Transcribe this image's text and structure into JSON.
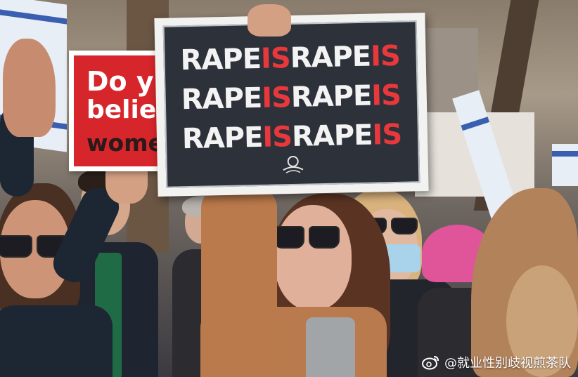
{
  "red_sign": {
    "line1": "Do y",
    "line2": "believe",
    "line3": "women"
  },
  "main_sign": {
    "rows": [
      [
        {
          "text": "RAPE",
          "tone": "white"
        },
        {
          "text": "IS",
          "tone": "red"
        },
        {
          "text": "RAPE",
          "tone": "white"
        },
        {
          "text": "IS",
          "tone": "red"
        }
      ],
      [
        {
          "text": "RAPE",
          "tone": "white"
        },
        {
          "text": "IS",
          "tone": "red"
        },
        {
          "text": "RAPE",
          "tone": "white"
        },
        {
          "text": "IS",
          "tone": "red"
        }
      ],
      [
        {
          "text": "RAPE",
          "tone": "white"
        },
        {
          "text": "IS",
          "tone": "red"
        },
        {
          "text": "RAPE",
          "tone": "white"
        },
        {
          "text": "IS",
          "tone": "red"
        }
      ]
    ],
    "logo_icon": "organization-emblem-icon"
  },
  "watermark": {
    "icon": "weibo-icon",
    "text": "@就业性别歧视煎茶队"
  },
  "colors": {
    "sign_dark": "#2d3139",
    "sign_red_text": "#e8383c",
    "red_sign_bg": "#d6262b",
    "coat": "#b9764a",
    "beanie": "#e0559a",
    "mask": "#a9d3ea"
  }
}
